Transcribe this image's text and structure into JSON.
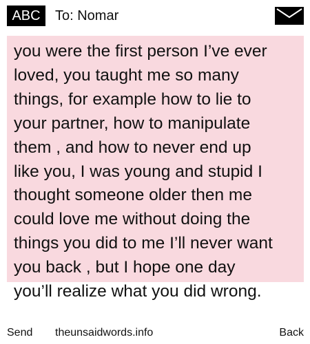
{
  "header": {
    "badge_label": "ABC",
    "recipient": "To: Nomar",
    "envelope_icon": "envelope-icon"
  },
  "message": {
    "background_color": "#f9d9df",
    "text": "you were the first person I’ve ever\nloved, you taught me so many\nthings, for example how to lie to\nyour partner, how to manipulate\nthem , and how to never end up\nlike you, I was young and stupid I\nthought someone older then me\ncould love me without doing the\nthings you did to me I’ll never want\nyou back , but I hope one day\nyou’ll realize what you did wrong."
  },
  "footer": {
    "send_label": "Send",
    "site_label": "theunsaidwords.info",
    "back_label": "Back"
  }
}
